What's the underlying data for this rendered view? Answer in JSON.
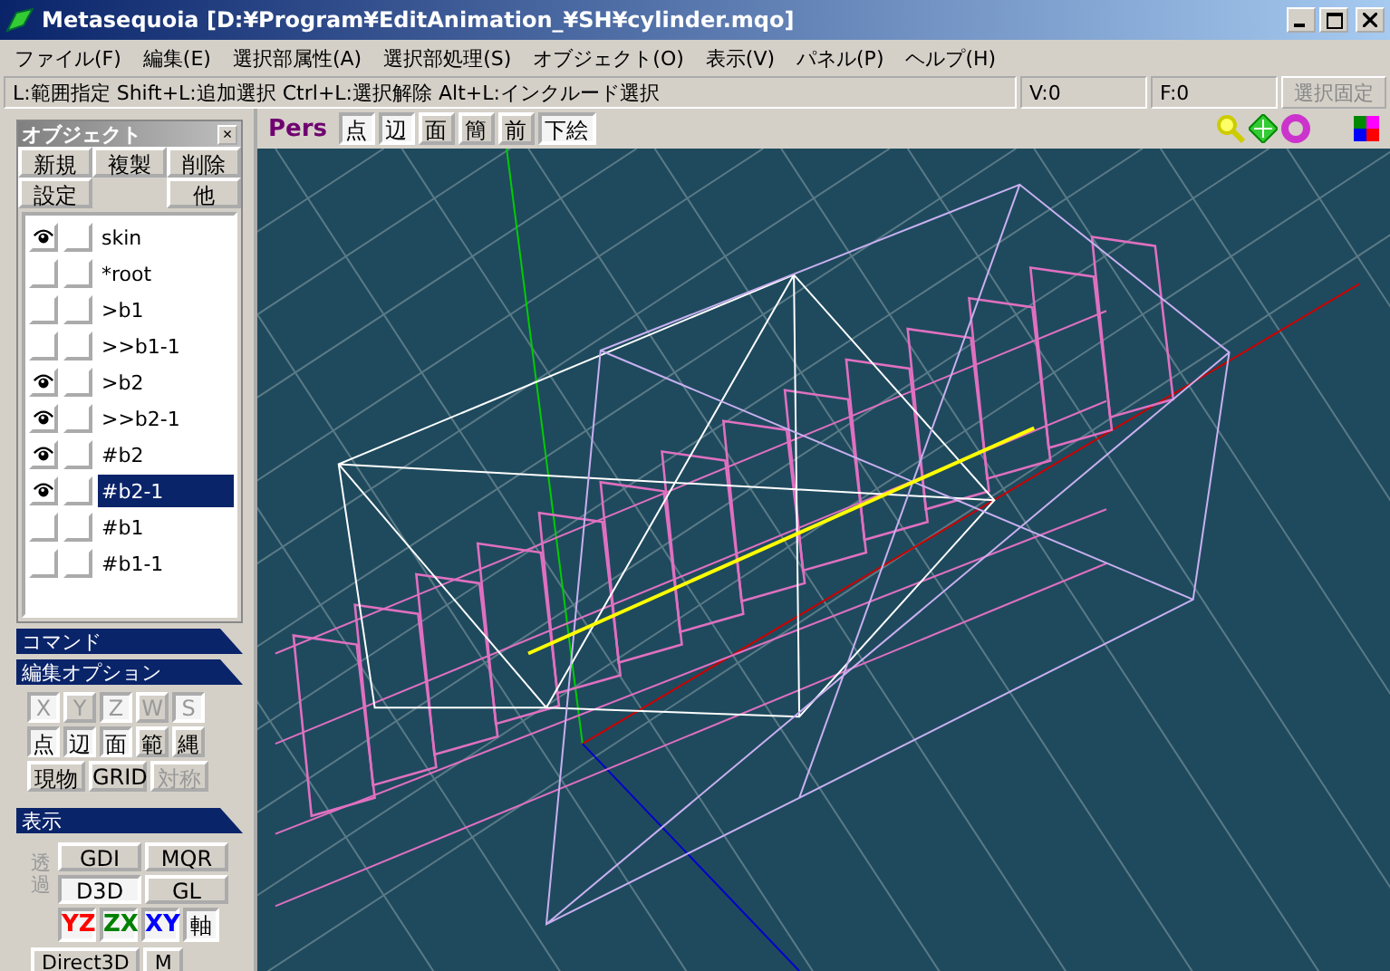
{
  "window": {
    "title": "Metasequoia [D:¥Program¥EditAnimation_¥SH¥cylinder.mqo]"
  },
  "menu": [
    "ファイル(F)",
    "編集(E)",
    "選択部属性(A)",
    "選択部処理(S)",
    "オブジェクト(O)",
    "表示(V)",
    "パネル(P)",
    "ヘルプ(H)"
  ],
  "status_bar": {
    "hint": "L:範囲指定  Shift+L:追加選択  Ctrl+L:選択解除  Alt+L:インクルード選択",
    "vertices": "V:0",
    "faces": "F:0",
    "lock_button": "選択固定"
  },
  "object_panel": {
    "title": "オブジェクト",
    "close": "×",
    "buttons": [
      {
        "label": "新規"
      },
      {
        "label": "複製"
      },
      {
        "label": "削除"
      },
      {
        "label": "設定"
      },
      {
        "label": "他"
      }
    ],
    "objects": [
      {
        "name": "skin",
        "visible": true,
        "selected": false
      },
      {
        "name": "*root",
        "visible": false,
        "selected": false
      },
      {
        "name": ">b1",
        "visible": false,
        "selected": false
      },
      {
        "name": ">>b1-1",
        "visible": false,
        "selected": false
      },
      {
        "name": ">b2",
        "visible": true,
        "selected": false
      },
      {
        "name": ">>b2-1",
        "visible": true,
        "selected": false
      },
      {
        "name": "#b2",
        "visible": true,
        "selected": false
      },
      {
        "name": "#b2-1",
        "visible": true,
        "selected": true
      },
      {
        "name": "#b1",
        "visible": false,
        "selected": false
      },
      {
        "name": "#b1-1",
        "visible": false,
        "selected": false
      }
    ]
  },
  "command_panel": {
    "title": "コマンド"
  },
  "edit_options": {
    "title": "編集オプション",
    "axis_locks": [
      {
        "label": "X",
        "pressed": true,
        "disabled": true
      },
      {
        "label": "Y",
        "pressed": false,
        "disabled": true
      },
      {
        "label": "Z",
        "pressed": true,
        "disabled": true
      },
      {
        "label": "W",
        "pressed": false,
        "disabled": true
      },
      {
        "label": "S",
        "pressed": true,
        "disabled": true
      }
    ],
    "select_modes": [
      {
        "label": "点",
        "pressed": true,
        "disabled": false
      },
      {
        "label": "辺",
        "pressed": true,
        "disabled": false
      },
      {
        "label": "面",
        "pressed": true,
        "disabled": false
      },
      {
        "label": "範",
        "pressed": false,
        "disabled": false
      },
      {
        "label": "縄",
        "pressed": false,
        "disabled": false
      }
    ],
    "snap_options": [
      {
        "label": "現物",
        "pressed": false,
        "disabled": false
      },
      {
        "label": "GRID",
        "pressed": false,
        "disabled": false
      },
      {
        "label": "対称",
        "pressed": false,
        "disabled": true
      }
    ]
  },
  "display_panel": {
    "title": "表示",
    "transparent": "透過",
    "renderers": [
      {
        "label": "GDI",
        "selected": false
      },
      {
        "label": "MQR",
        "selected": false
      },
      {
        "label": "D3D",
        "selected": true
      },
      {
        "label": "GL",
        "selected": false
      }
    ],
    "views": [
      {
        "label": "YZ",
        "color": "#ff0000"
      },
      {
        "label": "ZX",
        "color": "#008000"
      },
      {
        "label": "XY",
        "color": "#0000ff"
      }
    ],
    "axis_button": "軸",
    "bottom_buttons": [
      "Direct3D",
      "M"
    ]
  },
  "viewport": {
    "mode": "Pers",
    "buttons": [
      {
        "label": "点",
        "pressed": true
      },
      {
        "label": "辺",
        "pressed": true
      },
      {
        "label": "面",
        "pressed": false
      },
      {
        "label": "簡",
        "pressed": false
      },
      {
        "label": "前",
        "pressed": false
      },
      {
        "label": "下絵",
        "pressed": true
      }
    ]
  }
}
